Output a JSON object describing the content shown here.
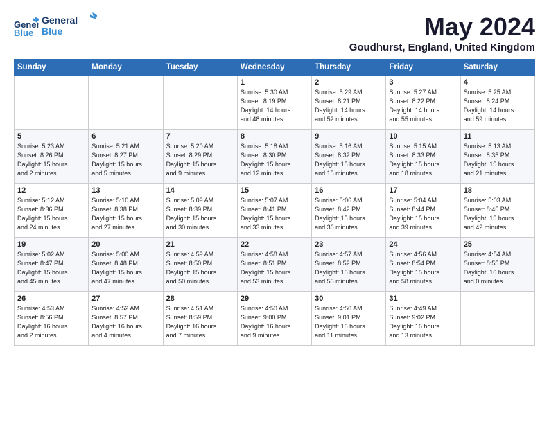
{
  "header": {
    "logo_general": "General",
    "logo_blue": "Blue",
    "month_title": "May 2024",
    "location": "Goudhurst, England, United Kingdom"
  },
  "weekdays": [
    "Sunday",
    "Monday",
    "Tuesday",
    "Wednesday",
    "Thursday",
    "Friday",
    "Saturday"
  ],
  "weeks": [
    [
      {
        "day": "",
        "text": ""
      },
      {
        "day": "",
        "text": ""
      },
      {
        "day": "",
        "text": ""
      },
      {
        "day": "1",
        "text": "Sunrise: 5:30 AM\nSunset: 8:19 PM\nDaylight: 14 hours\nand 48 minutes."
      },
      {
        "day": "2",
        "text": "Sunrise: 5:29 AM\nSunset: 8:21 PM\nDaylight: 14 hours\nand 52 minutes."
      },
      {
        "day": "3",
        "text": "Sunrise: 5:27 AM\nSunset: 8:22 PM\nDaylight: 14 hours\nand 55 minutes."
      },
      {
        "day": "4",
        "text": "Sunrise: 5:25 AM\nSunset: 8:24 PM\nDaylight: 14 hours\nand 59 minutes."
      }
    ],
    [
      {
        "day": "5",
        "text": "Sunrise: 5:23 AM\nSunset: 8:26 PM\nDaylight: 15 hours\nand 2 minutes."
      },
      {
        "day": "6",
        "text": "Sunrise: 5:21 AM\nSunset: 8:27 PM\nDaylight: 15 hours\nand 5 minutes."
      },
      {
        "day": "7",
        "text": "Sunrise: 5:20 AM\nSunset: 8:29 PM\nDaylight: 15 hours\nand 9 minutes."
      },
      {
        "day": "8",
        "text": "Sunrise: 5:18 AM\nSunset: 8:30 PM\nDaylight: 15 hours\nand 12 minutes."
      },
      {
        "day": "9",
        "text": "Sunrise: 5:16 AM\nSunset: 8:32 PM\nDaylight: 15 hours\nand 15 minutes."
      },
      {
        "day": "10",
        "text": "Sunrise: 5:15 AM\nSunset: 8:33 PM\nDaylight: 15 hours\nand 18 minutes."
      },
      {
        "day": "11",
        "text": "Sunrise: 5:13 AM\nSunset: 8:35 PM\nDaylight: 15 hours\nand 21 minutes."
      }
    ],
    [
      {
        "day": "12",
        "text": "Sunrise: 5:12 AM\nSunset: 8:36 PM\nDaylight: 15 hours\nand 24 minutes."
      },
      {
        "day": "13",
        "text": "Sunrise: 5:10 AM\nSunset: 8:38 PM\nDaylight: 15 hours\nand 27 minutes."
      },
      {
        "day": "14",
        "text": "Sunrise: 5:09 AM\nSunset: 8:39 PM\nDaylight: 15 hours\nand 30 minutes."
      },
      {
        "day": "15",
        "text": "Sunrise: 5:07 AM\nSunset: 8:41 PM\nDaylight: 15 hours\nand 33 minutes."
      },
      {
        "day": "16",
        "text": "Sunrise: 5:06 AM\nSunset: 8:42 PM\nDaylight: 15 hours\nand 36 minutes."
      },
      {
        "day": "17",
        "text": "Sunrise: 5:04 AM\nSunset: 8:44 PM\nDaylight: 15 hours\nand 39 minutes."
      },
      {
        "day": "18",
        "text": "Sunrise: 5:03 AM\nSunset: 8:45 PM\nDaylight: 15 hours\nand 42 minutes."
      }
    ],
    [
      {
        "day": "19",
        "text": "Sunrise: 5:02 AM\nSunset: 8:47 PM\nDaylight: 15 hours\nand 45 minutes."
      },
      {
        "day": "20",
        "text": "Sunrise: 5:00 AM\nSunset: 8:48 PM\nDaylight: 15 hours\nand 47 minutes."
      },
      {
        "day": "21",
        "text": "Sunrise: 4:59 AM\nSunset: 8:50 PM\nDaylight: 15 hours\nand 50 minutes."
      },
      {
        "day": "22",
        "text": "Sunrise: 4:58 AM\nSunset: 8:51 PM\nDaylight: 15 hours\nand 53 minutes."
      },
      {
        "day": "23",
        "text": "Sunrise: 4:57 AM\nSunset: 8:52 PM\nDaylight: 15 hours\nand 55 minutes."
      },
      {
        "day": "24",
        "text": "Sunrise: 4:56 AM\nSunset: 8:54 PM\nDaylight: 15 hours\nand 58 minutes."
      },
      {
        "day": "25",
        "text": "Sunrise: 4:54 AM\nSunset: 8:55 PM\nDaylight: 16 hours\nand 0 minutes."
      }
    ],
    [
      {
        "day": "26",
        "text": "Sunrise: 4:53 AM\nSunset: 8:56 PM\nDaylight: 16 hours\nand 2 minutes."
      },
      {
        "day": "27",
        "text": "Sunrise: 4:52 AM\nSunset: 8:57 PM\nDaylight: 16 hours\nand 4 minutes."
      },
      {
        "day": "28",
        "text": "Sunrise: 4:51 AM\nSunset: 8:59 PM\nDaylight: 16 hours\nand 7 minutes."
      },
      {
        "day": "29",
        "text": "Sunrise: 4:50 AM\nSunset: 9:00 PM\nDaylight: 16 hours\nand 9 minutes."
      },
      {
        "day": "30",
        "text": "Sunrise: 4:50 AM\nSunset: 9:01 PM\nDaylight: 16 hours\nand 11 minutes."
      },
      {
        "day": "31",
        "text": "Sunrise: 4:49 AM\nSunset: 9:02 PM\nDaylight: 16 hours\nand 13 minutes."
      },
      {
        "day": "",
        "text": ""
      }
    ]
  ]
}
